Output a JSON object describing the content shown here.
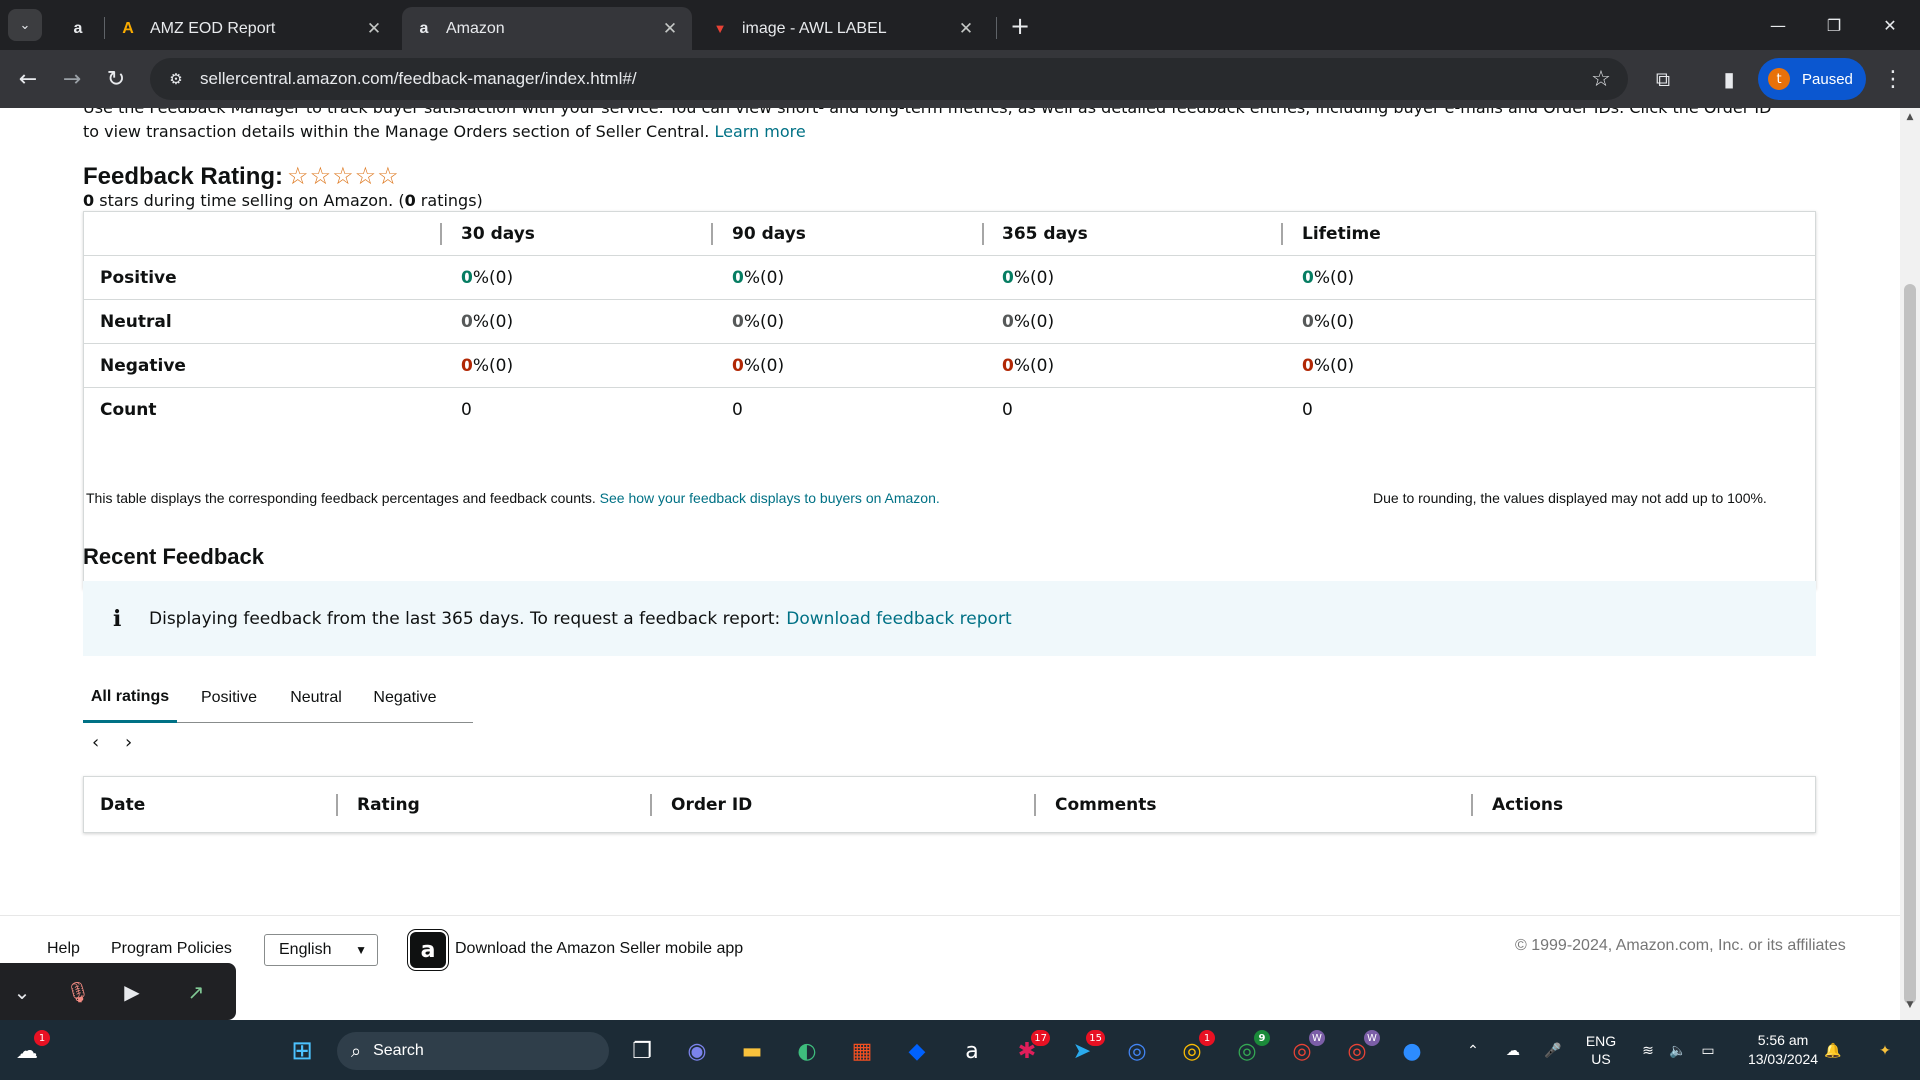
{
  "browser": {
    "tabs": [
      {
        "title": "AMZ EOD Report",
        "favicon": "A",
        "close": "✕"
      },
      {
        "title": "Amazon",
        "favicon": "a",
        "close": "✕",
        "active": true
      },
      {
        "title": "image - AWL LABEL",
        "favicon": "▼",
        "close": "✕"
      }
    ],
    "pinned_tab_favicon": "a",
    "url": "sellercentral.amazon.com/feedback-manager/index.html#/",
    "profile_initial": "t",
    "profile_status": "Paused"
  },
  "intro": {
    "line1": "Use the Feedback Manager to track buyer satisfaction with your service. You can view short- and long-term metrics, as well as detailed feedback entries, including buyer e-mails and Order IDs. Click the Order ID",
    "line2": "to view transaction details within the Manage Orders section of Seller Central.",
    "learn_more": "Learn more"
  },
  "feedback_rating": {
    "title": "Feedback Rating:",
    "stars": "☆☆☆☆☆",
    "stars_value": "0",
    "stars_text": " stars during time selling on Amazon. (",
    "ratings_value": "0",
    "ratings_text": " ratings)"
  },
  "metrics": {
    "columns": [
      "30 days",
      "90 days",
      "365 days",
      "Lifetime"
    ],
    "rows": [
      {
        "label": "Positive",
        "cells": [
          {
            "value": "0",
            "suffix": " %(0)"
          },
          {
            "value": "0",
            "suffix": " %(0)"
          },
          {
            "value": "0",
            "suffix": " %(0)"
          },
          {
            "value": "0",
            "suffix": " %(0)"
          }
        ]
      },
      {
        "label": "Neutral",
        "cells": [
          {
            "value": "0",
            "suffix": " %(0)"
          },
          {
            "value": "0",
            "suffix": " %(0)"
          },
          {
            "value": "0",
            "suffix": " %(0)"
          },
          {
            "value": "0",
            "suffix": " %(0)"
          }
        ]
      },
      {
        "label": "Negative",
        "cells": [
          {
            "value": "0",
            "suffix": " %(0)"
          },
          {
            "value": "0",
            "suffix": " %(0)"
          },
          {
            "value": "0",
            "suffix": " %(0)"
          },
          {
            "value": "0",
            "suffix": " %(0)"
          }
        ]
      },
      {
        "label": "Count",
        "cells": [
          {
            "value": "0",
            "suffix": ""
          },
          {
            "value": "0",
            "suffix": ""
          },
          {
            "value": "0",
            "suffix": ""
          },
          {
            "value": "0",
            "suffix": ""
          }
        ]
      }
    ],
    "colors": {
      "positive": "#067d62",
      "neutral": "#565959",
      "negative": "#b12704"
    },
    "note_left": "This table displays the corresponding feedback percentages and feedback counts.",
    "note_link": "See how your feedback displays to buyers on Amazon.",
    "note_right": "Due to rounding, the values displayed may not add up to 100%."
  },
  "recent_feedback": {
    "title": "Recent Feedback",
    "alert_text": "Displaying feedback from the last 365 days. To request a feedback report:",
    "alert_link": "Download feedback report",
    "tabs": [
      "All ratings",
      "Positive",
      "Neutral",
      "Negative"
    ],
    "active_tab": "All ratings",
    "table_headers": [
      "Date",
      "Rating",
      "Order ID",
      "Comments",
      "Actions"
    ]
  },
  "footer": {
    "help": "Help",
    "program_policies": "Program Policies",
    "language": "English",
    "app_text": "Download the Amazon Seller mobile app",
    "copyright": "© 1999-2024, Amazon.com, Inc. or its affiliates"
  },
  "taskbar": {
    "search_placeholder": "Search",
    "badges": {
      "weather": "1",
      "slack": "17",
      "telegram": "15",
      "chrome_main": "1",
      "chrome_g": "9",
      "chrome_w1": "W",
      "chrome_w2": "W"
    },
    "lang_top": "ENG",
    "lang_bottom": "US",
    "time": "5:56 am",
    "date": "13/03/2024"
  }
}
